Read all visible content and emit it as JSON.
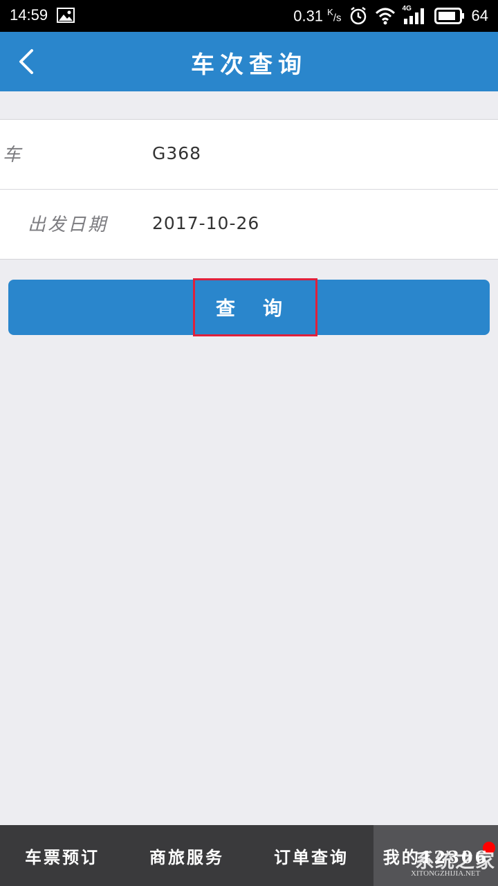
{
  "status_bar": {
    "time": "14:59",
    "net_speed_value": "0.31",
    "net_speed_unit_top": "K",
    "net_speed_unit_bottom": "/s",
    "network_type": "4G",
    "battery_level": "64",
    "icons": [
      "image-icon",
      "alarm-icon",
      "wifi-icon",
      "signal-icon",
      "battery-icon"
    ]
  },
  "app_bar": {
    "title": "车次查询",
    "back_icon": "chevron-left-icon",
    "background": "#2a86cc"
  },
  "form": {
    "train_no_label": "车",
    "train_no_value": "G368",
    "date_label": "出发日期",
    "date_value": "2017-10-26"
  },
  "query_button": {
    "label": "查询",
    "background": "#2a86cc",
    "highlight_color": "#e0203a"
  },
  "bottom_nav": {
    "items": [
      {
        "label": "车票预订"
      },
      {
        "label": "商旅服务"
      },
      {
        "label": "订单查询"
      },
      {
        "label": "我的12306"
      }
    ],
    "active_index": 3,
    "badge_color": "#ff0000"
  },
  "watermark": {
    "text": "系统之家",
    "sub": "XITONGZHIJIA.NET"
  }
}
